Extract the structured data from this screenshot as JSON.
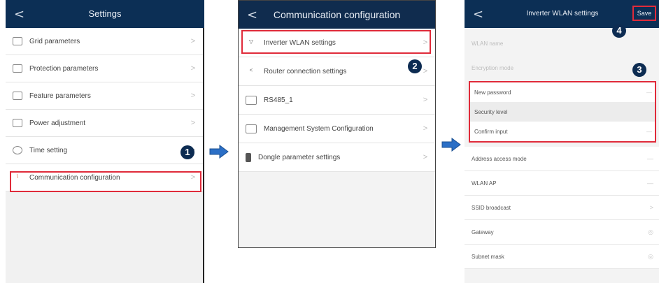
{
  "screen1": {
    "title": "Settings",
    "back_glyph": "<",
    "items": [
      {
        "label": "Grid parameters",
        "icon": "grid-icon"
      },
      {
        "label": "Protection parameters",
        "icon": "shield-icon"
      },
      {
        "label": "Feature parameters",
        "icon": "feature-icon"
      },
      {
        "label": "Power adjustment",
        "icon": "power-icon"
      },
      {
        "label": "Time setting",
        "icon": "clock-icon"
      },
      {
        "label": "Communication configuration",
        "icon": "communication-icon"
      }
    ],
    "chevron": ">",
    "step": "1"
  },
  "screen2": {
    "title": "Communication configuration",
    "back_glyph": "<",
    "items": [
      {
        "label": "Inverter WLAN settings",
        "icon": "wifi-icon"
      },
      {
        "label": "Router connection settings",
        "icon": "share-icon"
      },
      {
        "label": "RS485_1",
        "icon": "rs485-icon"
      },
      {
        "label": "Management System Configuration",
        "icon": "management-icon"
      },
      {
        "label": "Dongle parameter settings",
        "icon": "dongle-icon"
      }
    ],
    "chevron": ">",
    "step": "2"
  },
  "screen3": {
    "title": "Inverter WLAN settings",
    "back_glyph": "<",
    "save_label": "Save",
    "hint1": "WLAN name",
    "hint2": "Encryption mode",
    "fields": [
      {
        "label": "New password"
      },
      {
        "label": "Security level"
      },
      {
        "label": "Confirm input"
      }
    ],
    "rows": [
      {
        "label": "Address access mode",
        "right": "—"
      },
      {
        "label": "WLAN AP",
        "right": "—"
      },
      {
        "label": "SSID broadcast",
        "right": ">"
      },
      {
        "label": "Gateway",
        "right": "◎"
      },
      {
        "label": "Subnet mask",
        "right": "◎"
      }
    ],
    "step_fields": "3",
    "step_save": "4"
  },
  "colors": {
    "header": "#0c2f55",
    "highlight": "#e02b3a",
    "arrow": "#2b6fc6",
    "step_badge": "#0d2c52"
  }
}
